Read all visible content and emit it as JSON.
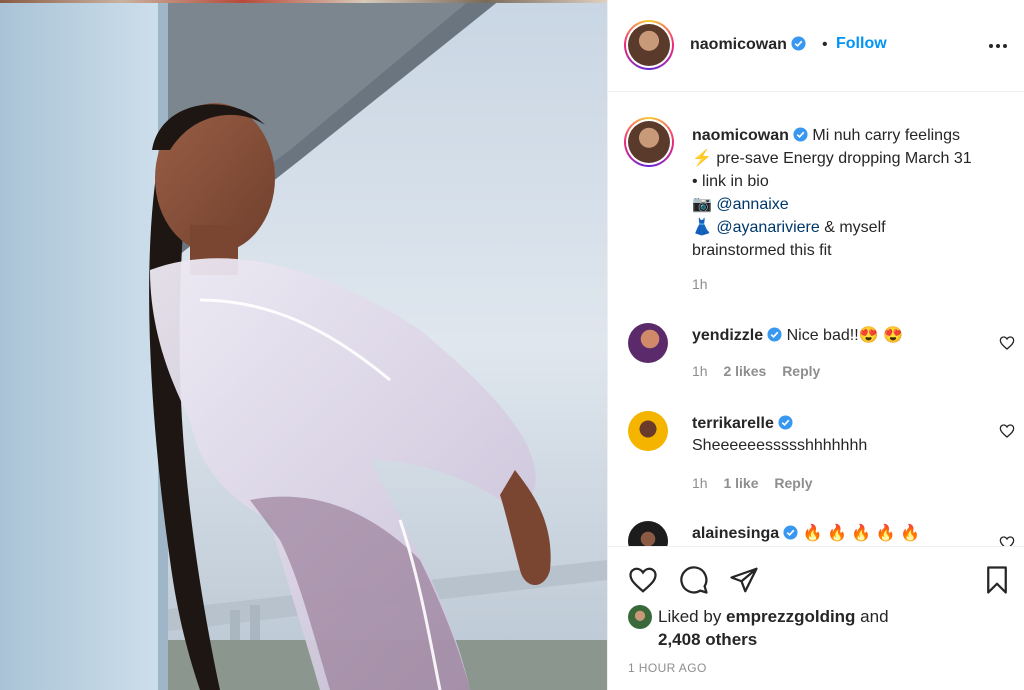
{
  "post": {
    "username": "naomicowan",
    "follow_label": "Follow",
    "separator": "•"
  },
  "caption": {
    "username": "naomicowan",
    "lines": [
      "Mi nuh carry feelings",
      "⚡ pre-save Energy dropping March 31",
      "• link in bio"
    ],
    "camera_emoji": "📷",
    "dress_emoji": "👗",
    "photo_mention": "@annaixe",
    "stylist_mention": "@ayanariviere",
    "stylist_suffix": " & myself",
    "last_line": "brainstormed this fit",
    "time": "1h"
  },
  "comments": [
    {
      "username": "yendizzle",
      "text": "Nice bad!!😍 😍",
      "time": "1h",
      "likes": "2 likes",
      "reply": "Reply",
      "avatar_color": "#5a2a6a"
    },
    {
      "username": "terrikarelle",
      "text": "Sheeeeeessssshhhhhhh",
      "time": "1h",
      "likes": "1 like",
      "reply": "Reply",
      "avatar_color": "#f4b400"
    },
    {
      "username": "alainesinga",
      "text": "🔥 🔥 🔥 🔥 🔥",
      "avatar_color": "#1c1c1c"
    }
  ],
  "likes": {
    "prefix": "Liked by ",
    "user": "emprezzgolding",
    "middle": " and",
    "others": "2,408 others"
  },
  "timestamp": "1 HOUR AGO",
  "colors": {
    "accent": "#0095f6",
    "verified": "#3897f0",
    "mention": "#00376b",
    "muted": "#8e8e8e"
  },
  "icons": [
    "heart-icon",
    "comment-icon",
    "share-icon",
    "bookmark-icon",
    "more-icon",
    "verified-icon"
  ]
}
